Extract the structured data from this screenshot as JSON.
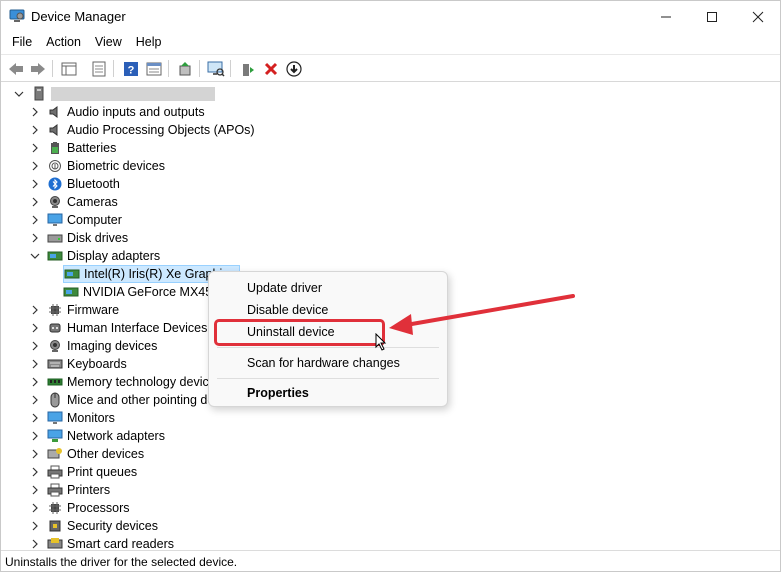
{
  "window": {
    "title": "Device Manager",
    "controls": {
      "minimize": "–",
      "maximize": "□",
      "close": "✕"
    }
  },
  "menu": [
    "File",
    "Action",
    "View",
    "Help"
  ],
  "toolbar_icons": [
    "back-arrow-icon",
    "forward-arrow-icon",
    "show-hide-console-tree-icon",
    "properties-icon",
    "help-icon",
    "view-icon",
    "update-driver-icon",
    "scan-hardware-icon",
    "enable-device-icon",
    "uninstall-icon",
    "disable-device-icon"
  ],
  "tree": {
    "root_label": "",
    "categories": [
      {
        "label": "Audio inputs and outputs",
        "icon": "speaker-icon"
      },
      {
        "label": "Audio Processing Objects (APOs)",
        "icon": "speaker-icon"
      },
      {
        "label": "Batteries",
        "icon": "battery-icon"
      },
      {
        "label": "Biometric devices",
        "icon": "fingerprint-icon"
      },
      {
        "label": "Bluetooth",
        "icon": "bluetooth-icon"
      },
      {
        "label": "Cameras",
        "icon": "camera-icon"
      },
      {
        "label": "Computer",
        "icon": "monitor-icon"
      },
      {
        "label": "Disk drives",
        "icon": "disk-drive-icon"
      },
      {
        "label": "Display adapters",
        "icon": "display-adapter-icon"
      },
      {
        "label": "Firmware",
        "icon": "chip-icon"
      },
      {
        "label": "Human Interface Devices",
        "icon": "hid-icon"
      },
      {
        "label": "Imaging devices",
        "icon": "camera-icon"
      },
      {
        "label": "Keyboards",
        "icon": "keyboard-icon"
      },
      {
        "label": "Memory technology devices",
        "icon": "memory-icon"
      },
      {
        "label": "Mice and other pointing devices",
        "icon": "mouse-icon"
      },
      {
        "label": "Monitors",
        "icon": "monitor-icon"
      },
      {
        "label": "Network adapters",
        "icon": "network-icon"
      },
      {
        "label": "Other devices",
        "icon": "other-device-icon"
      },
      {
        "label": "Print queues",
        "icon": "printer-icon"
      },
      {
        "label": "Printers",
        "icon": "printer-icon"
      },
      {
        "label": "Processors",
        "icon": "chip-icon"
      },
      {
        "label": "Security devices",
        "icon": "security-icon"
      },
      {
        "label": "Smart card readers",
        "icon": "card-reader-icon"
      }
    ],
    "display_adapters_children": [
      {
        "label": "Intel(R) Iris(R) Xe Graphics",
        "selected": true
      },
      {
        "label": "NVIDIA GeForce MX450",
        "selected": false
      }
    ]
  },
  "context_menu": {
    "items": [
      "Update driver",
      "Disable device",
      "Uninstall device",
      "Scan for hardware changes",
      "Properties"
    ]
  },
  "status": "Uninstalls the driver for the selected device.",
  "colors": {
    "highlight": "#e0303a",
    "selection": "#cce8ff"
  }
}
